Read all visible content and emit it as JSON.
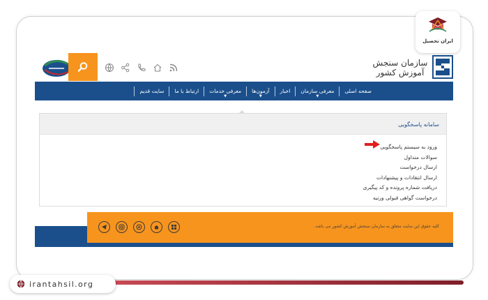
{
  "brand": {
    "name": "ایران تحصیل",
    "url": "irantahsil.org"
  },
  "header": {
    "org_title": "سازمان سنجش آموزش کشور",
    "icons": [
      "rss-icon",
      "home-icon",
      "phone-icon",
      "share-icon",
      "globe-icon"
    ]
  },
  "nav": {
    "items": [
      {
        "label": "صفحه اصلی",
        "dropdown": false
      },
      {
        "label": "معرفی سازمان",
        "dropdown": true
      },
      {
        "label": "اخبار",
        "dropdown": false
      },
      {
        "label": "آزمون‌ها",
        "dropdown": true
      },
      {
        "label": "معرفی خدمات",
        "dropdown": true
      },
      {
        "label": "ارتباط با ما",
        "dropdown": false
      },
      {
        "label": "سایت قدیم",
        "dropdown": false
      }
    ]
  },
  "panel": {
    "title": "سامانه پاسخگویی",
    "links": [
      "ورود به سیستم پاسخگویی",
      "سوالات متداول",
      "ارسال درخواست",
      "ارسال انتقادات و پیشنهادات",
      "دریافت شماره پرونده و کد پیگیری",
      "درخواست گواهی قبولی ورتبه"
    ]
  },
  "footer": {
    "copyright": "کلیه حقوق این سایت متعلق به سازمان سنجش آموزش کشور می باشد.",
    "socials": [
      "windows-icon",
      "android-icon",
      "browser-icon",
      "instagram-icon",
      "telegram-icon"
    ]
  },
  "colors": {
    "navy": "#1b4f8c",
    "orange": "#f7941d",
    "maroon": "#7e1f29",
    "arrow": "#e02020"
  }
}
